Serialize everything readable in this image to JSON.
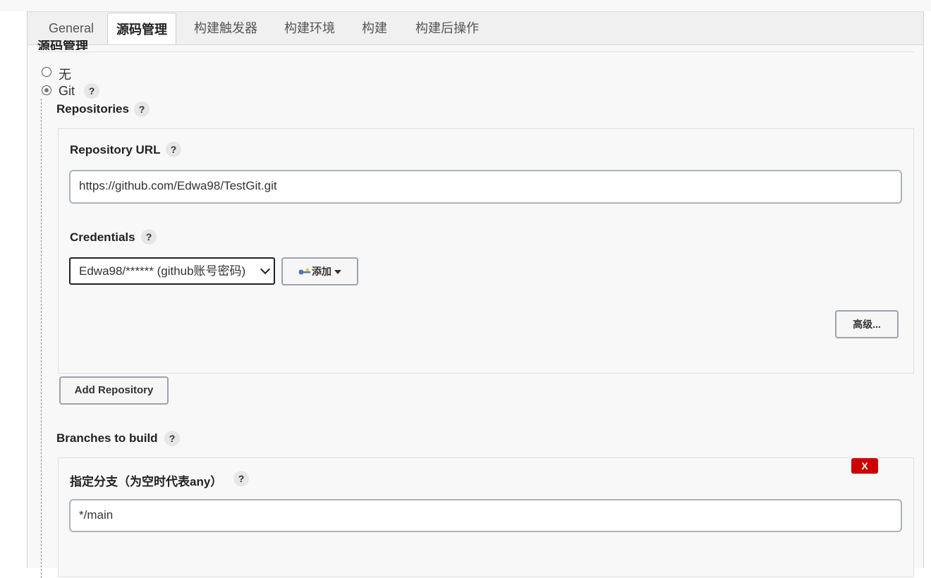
{
  "tabs": [
    {
      "label": "General"
    },
    {
      "label": "源码管理"
    },
    {
      "label": "构建触发器"
    },
    {
      "label": "构建环境"
    },
    {
      "label": "构建"
    },
    {
      "label": "构建后操作"
    }
  ],
  "section_heading": "源码管理",
  "scm": {
    "options": [
      {
        "label": "无",
        "checked": false
      },
      {
        "label": "Git",
        "checked": true
      }
    ],
    "help": "?"
  },
  "repositories": {
    "title": "Repositories",
    "repo_url_label": "Repository URL",
    "repo_url_value": "https://github.com/Edwa98/TestGit.git",
    "credentials_label": "Credentials",
    "credentials_value": "Edwa98/****** (github账号密码)",
    "add_button": "添加",
    "advanced_button": "高级...",
    "add_repository_button": "Add Repository"
  },
  "branches": {
    "title": "Branches to build",
    "branch_label": "指定分支（为空时代表any）",
    "branch_value": "*/main",
    "delete_button": "X"
  },
  "colors": {
    "delete_red": "#cc0000",
    "panel_bg": "#f8f8f8"
  }
}
